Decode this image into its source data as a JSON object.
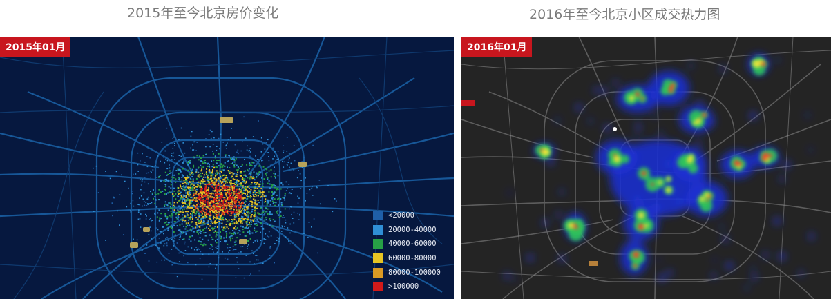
{
  "left_panel": {
    "title": "2015年至今北京房价变化",
    "badge": "2015年01月",
    "legend": [
      {
        "label": "<20000",
        "color": "#1f5fa8"
      },
      {
        "label": "20000-40000",
        "color": "#2f8fd6"
      },
      {
        "label": "40000-60000",
        "color": "#27a046"
      },
      {
        "label": "60000-80000",
        "color": "#e6c423"
      },
      {
        "label": "80000-100000",
        "color": "#d99a24"
      },
      {
        "label": ">100000",
        "color": "#d01a1a"
      }
    ]
  },
  "right_panel": {
    "title": "2016年至今北京小区成交热力图",
    "badge": "2016年01月"
  }
}
